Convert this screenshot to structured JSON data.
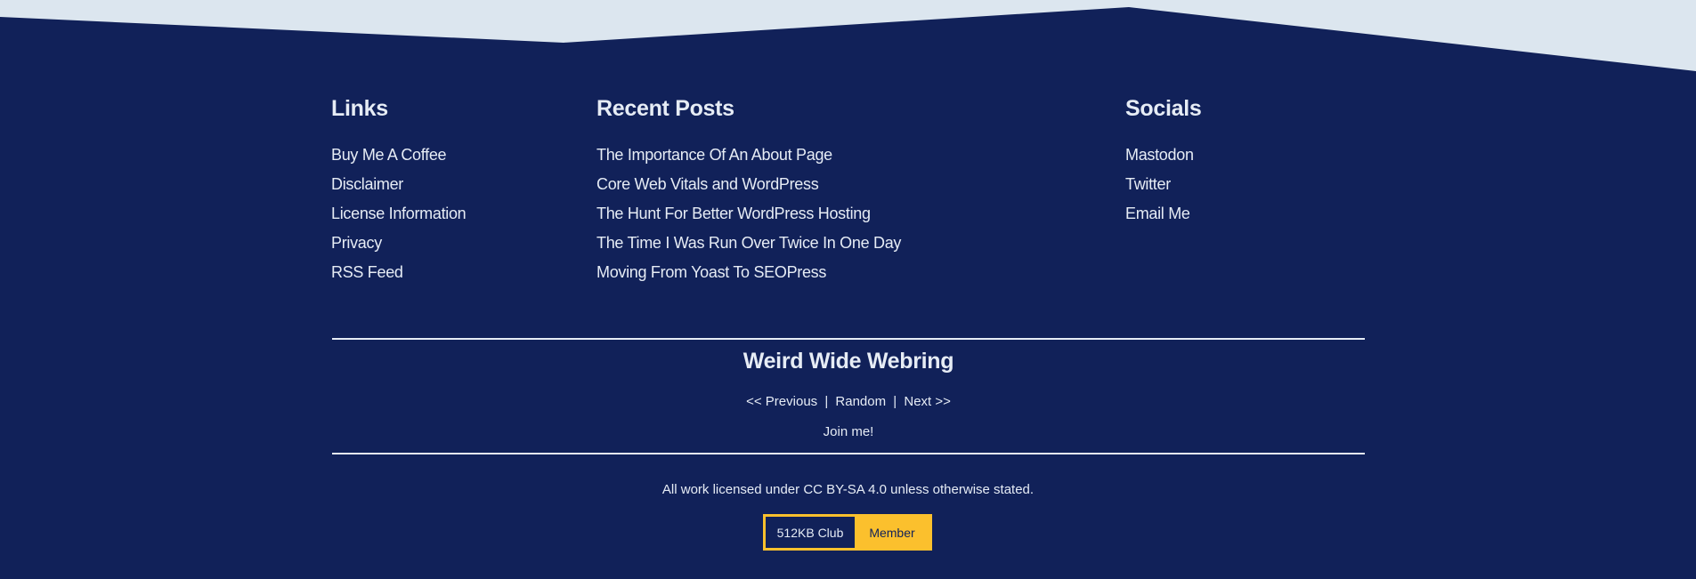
{
  "colors": {
    "background_top": "#dce6ef",
    "footer_bg": "#112159",
    "text": "#e6ecf5",
    "accent": "#fbc02d"
  },
  "links": {
    "title": "Links",
    "items": [
      {
        "label": "Buy Me A Coffee"
      },
      {
        "label": "Disclaimer"
      },
      {
        "label": "License Information"
      },
      {
        "label": "Privacy"
      },
      {
        "label": "RSS Feed"
      }
    ]
  },
  "recent_posts": {
    "title": "Recent Posts",
    "items": [
      {
        "label": "The Importance Of An About Page"
      },
      {
        "label": "Core Web Vitals and WordPress"
      },
      {
        "label": "The Hunt For Better WordPress Hosting"
      },
      {
        "label": "The Time I Was Run Over Twice In One Day"
      },
      {
        "label": "Moving From Yoast To SEOPress"
      }
    ]
  },
  "socials": {
    "title": "Socials",
    "items": [
      {
        "label": "Mastodon"
      },
      {
        "label": "Twitter"
      },
      {
        "label": "Email Me"
      }
    ]
  },
  "webring": {
    "title": "Weird Wide Webring",
    "previous": "<< Previous",
    "separator": "|",
    "random": "Random",
    "next": "Next >>",
    "join": "Join me!"
  },
  "license_text": "All work licensed under CC BY-SA 4.0 unless otherwise stated.",
  "badge": {
    "left": "512KB Club",
    "right": "Member"
  }
}
